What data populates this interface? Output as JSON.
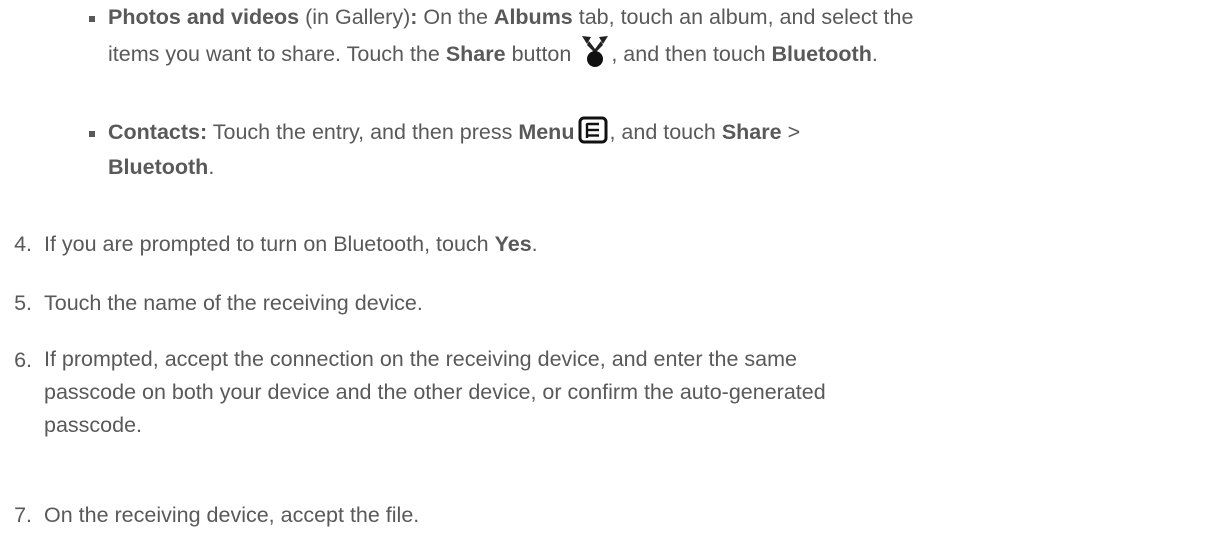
{
  "bullets": [
    {
      "label": "Photos and videos",
      "text1": " (in Gallery)",
      "colon": ":",
      "text2": " On the ",
      "albums": "Albums",
      "text3": " tab, touch an album, and select the",
      "text4": "items you want to share. Touch the ",
      "share": "Share",
      "text5": " button ",
      "text6": ", and then touch ",
      "bluetooth": "Bluetooth",
      "end": ".",
      "icon": "share-icon"
    },
    {
      "label": "Contacts:",
      "text1": " Touch the entry, and then press ",
      "menu": "Menu",
      "text2": ", and touch ",
      "share": "Share",
      "text3": " >",
      "bluetooth": "Bluetooth",
      "end": ".",
      "icon": "menu-icon"
    }
  ],
  "steps": [
    {
      "num": "4.",
      "pre": "If you are prompted to turn on Bluetooth, touch ",
      "bold": "Yes",
      "post": "."
    },
    {
      "num": "5.",
      "text": "Touch the name of the receiving device."
    },
    {
      "num": "6.",
      "line1": "If prompted, accept the connection on the receiving device, and enter the same",
      "line2": "passcode on both your device and the other device, or confirm the auto-generated",
      "line3": "passcode."
    },
    {
      "num": "7.",
      "text": "On the receiving device, accept the file."
    }
  ]
}
